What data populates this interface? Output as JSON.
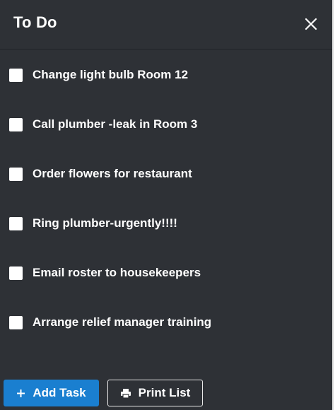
{
  "header": {
    "title": "To Do",
    "close_icon": "close-icon"
  },
  "tasks": [
    {
      "label": "Change light bulb Room 12",
      "checked": false
    },
    {
      "label": "Call plumber -leak in Room 3",
      "checked": false
    },
    {
      "label": "Order flowers for restaurant",
      "checked": false
    },
    {
      "label": "Ring plumber-urgently!!!!",
      "checked": false
    },
    {
      "label": "Email roster to housekeepers",
      "checked": false
    },
    {
      "label": "Arrange relief manager training",
      "checked": false
    }
  ],
  "footer": {
    "add_task_label": "Add Task",
    "add_task_icon": "plus-icon",
    "print_list_label": "Print List",
    "print_list_icon": "printer-icon"
  },
  "colors": {
    "panel_background": "#2e3136",
    "accent": "#1a7fd0",
    "text": "#ffffff"
  }
}
